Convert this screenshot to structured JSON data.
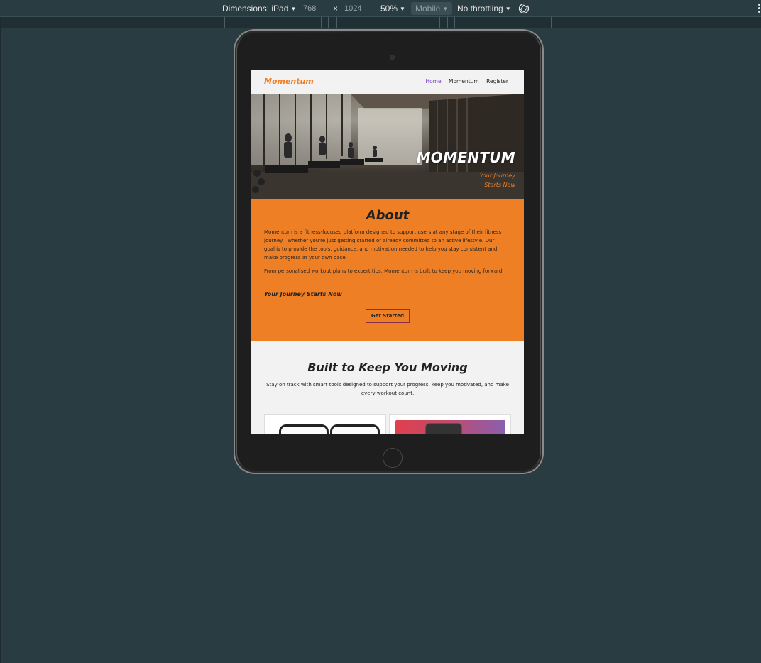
{
  "devtools": {
    "dimensions_label": "Dimensions: iPad",
    "width": "768",
    "times": "×",
    "height": "1024",
    "zoom": "50%",
    "device_type": "Mobile",
    "throttling": "No throttling"
  },
  "site": {
    "brand": "Momentum",
    "nav": {
      "home": "Home",
      "momentum": "Momentum",
      "register": "Register"
    },
    "hero": {
      "title": "MOMENTUM",
      "subtitle": "Your Journey Starts Now"
    },
    "about": {
      "heading": "About",
      "paragraph1": "Momentum is a fitness-focused platform designed to support users at any stage of their fitness journey—whether you're just getting started or already committed to an active lifestyle. Our goal is to provide the tools, guidance, and motivation needed to help you stay consistent and make progress at your own pace.",
      "paragraph2": "From personalised workout plans to expert tips, Momentum is built to keep you moving forward.",
      "tagline": "Your Journey Starts Now",
      "cta": "Get Started"
    },
    "features": {
      "heading": "Built to Keep You Moving",
      "description": "Stay on track with smart tools designed to support your progress, keep you motivated, and make every workout count."
    }
  },
  "colors": {
    "accent_orange": "#ee7f25",
    "nav_active": "#7b3fc9",
    "devtools_bg": "#283c42"
  }
}
